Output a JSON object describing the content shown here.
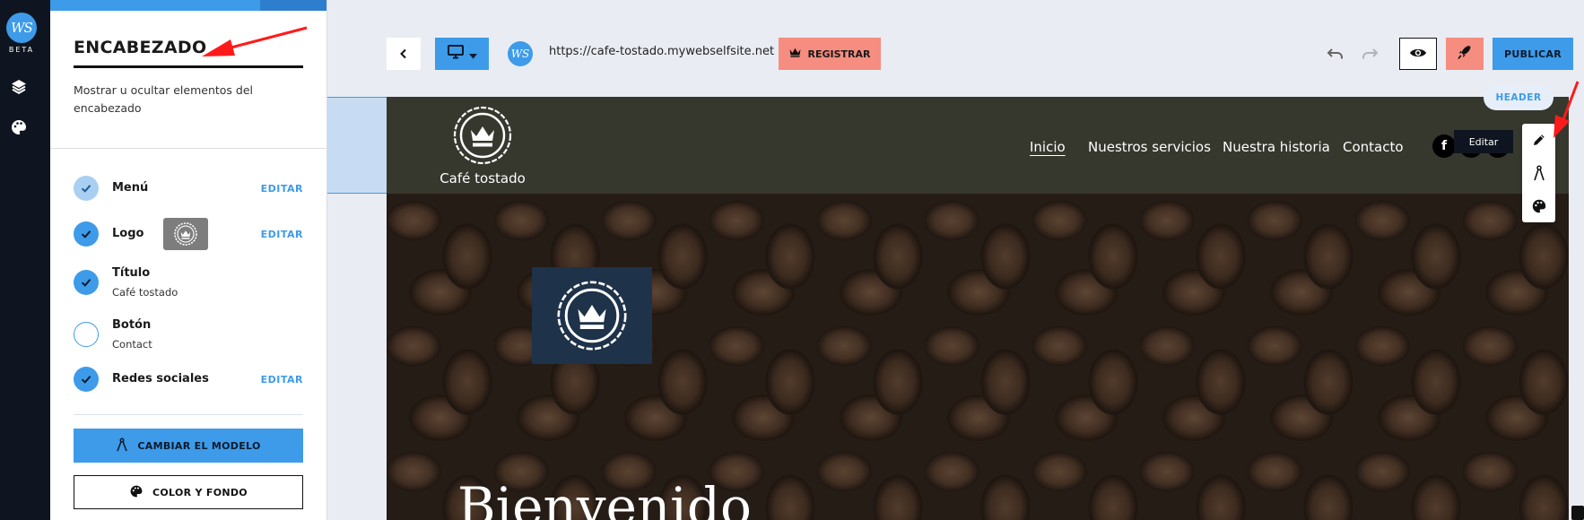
{
  "rail": {
    "logo_text": "WS",
    "beta_label": "BETA",
    "icons": [
      "layers-icon",
      "palette-icon"
    ]
  },
  "panel": {
    "title": "ENCABEZADO",
    "description": "Mostrar u ocultar elementos del encabezado",
    "items": [
      {
        "label": "Menú",
        "state": "partial",
        "action": "EDITAR"
      },
      {
        "label": "Logo",
        "state": "checked",
        "action": "EDITAR"
      },
      {
        "label": "Título",
        "sub": "Café tostado",
        "state": "checked"
      },
      {
        "label": "Botón",
        "sub": "Contact",
        "state": "unchecked"
      },
      {
        "label": "Redes sociales",
        "state": "checked",
        "action": "EDITAR"
      }
    ],
    "change_model_label": "CAMBIAR EL MODELO",
    "color_bg_label": "COLOR Y FONDO"
  },
  "toolbar": {
    "url": "https://cafe-tostado.mywebselfsite.net",
    "site_icon_text": "WS",
    "register_label": "REGISTRAR",
    "publish_label": "PUBLICAR",
    "icons": [
      "back-chevron-icon",
      "desktop-icon",
      "crown-icon",
      "undo-icon",
      "redo-icon",
      "eye-icon",
      "rocket-icon"
    ]
  },
  "site": {
    "brand_name": "Café tostado",
    "nav": [
      "Inicio",
      "Nuestros servicios",
      "Nuestra historia",
      "Contacto"
    ],
    "active_nav": "Inicio",
    "social": [
      "f"
    ],
    "hero_title": "Bienvenido"
  },
  "floating": {
    "section_badge": "HEADER",
    "tooltip": "Editar",
    "tools": [
      "pencil-icon",
      "compass-icon",
      "palette-icon"
    ]
  },
  "colors": {
    "accent": "#3d9be9",
    "register": "#f58d80",
    "rail": "#0e1520",
    "header_bg": "#36382e",
    "hero_logo_bg": "#1e3249",
    "annotation_arrow": "#ff1a1a"
  }
}
